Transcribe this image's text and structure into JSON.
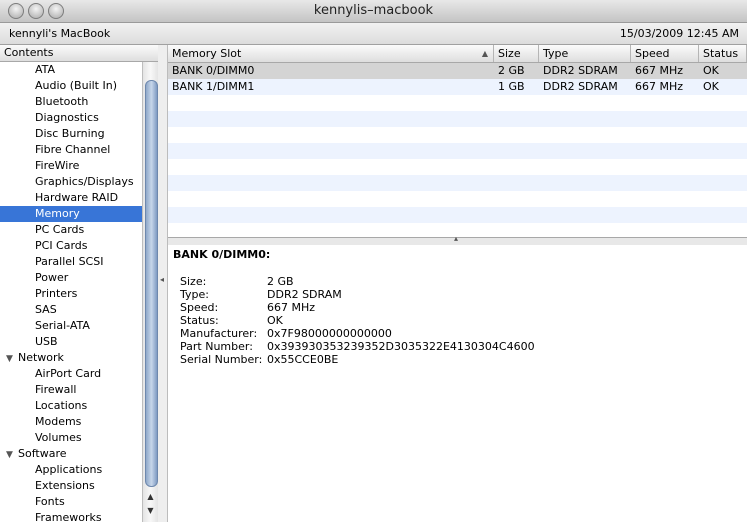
{
  "window": {
    "title": "kennylis–macbook"
  },
  "header": {
    "machine_name": "kennyli's MacBook",
    "datetime": "15/03/2009 12:45 AM"
  },
  "sidebar": {
    "header": "Contents",
    "items": [
      {
        "label": "ATA",
        "type": "item"
      },
      {
        "label": "Audio (Built In)",
        "type": "item"
      },
      {
        "label": "Bluetooth",
        "type": "item"
      },
      {
        "label": "Diagnostics",
        "type": "item"
      },
      {
        "label": "Disc Burning",
        "type": "item"
      },
      {
        "label": "Fibre Channel",
        "type": "item"
      },
      {
        "label": "FireWire",
        "type": "item"
      },
      {
        "label": "Graphics/Displays",
        "type": "item"
      },
      {
        "label": "Hardware RAID",
        "type": "item"
      },
      {
        "label": "Memory",
        "type": "item",
        "selected": true
      },
      {
        "label": "PC Cards",
        "type": "item"
      },
      {
        "label": "PCI Cards",
        "type": "item"
      },
      {
        "label": "Parallel SCSI",
        "type": "item"
      },
      {
        "label": "Power",
        "type": "item"
      },
      {
        "label": "Printers",
        "type": "item"
      },
      {
        "label": "SAS",
        "type": "item"
      },
      {
        "label": "Serial-ATA",
        "type": "item"
      },
      {
        "label": "USB",
        "type": "item"
      },
      {
        "label": "Network",
        "type": "group"
      },
      {
        "label": "AirPort Card",
        "type": "item"
      },
      {
        "label": "Firewall",
        "type": "item"
      },
      {
        "label": "Locations",
        "type": "item"
      },
      {
        "label": "Modems",
        "type": "item"
      },
      {
        "label": "Volumes",
        "type": "item"
      },
      {
        "label": "Software",
        "type": "group"
      },
      {
        "label": "Applications",
        "type": "item"
      },
      {
        "label": "Extensions",
        "type": "item"
      },
      {
        "label": "Fonts",
        "type": "item"
      },
      {
        "label": "Frameworks",
        "type": "item"
      }
    ]
  },
  "table": {
    "columns": [
      "Memory Slot",
      "Size",
      "Type",
      "Speed",
      "Status"
    ],
    "sort_column": "Memory Slot",
    "rows": [
      [
        "BANK 0/DIMM0",
        "2 GB",
        "DDR2 SDRAM",
        "667 MHz",
        "OK"
      ],
      [
        "BANK 1/DIMM1",
        "1 GB",
        "DDR2 SDRAM",
        "667 MHz",
        "OK"
      ]
    ],
    "selected_row": 0
  },
  "detail": {
    "title": "BANK 0/DIMM0:",
    "fields": [
      {
        "key": "Size:",
        "value": "2 GB"
      },
      {
        "key": "Type:",
        "value": "DDR2 SDRAM"
      },
      {
        "key": "Speed:",
        "value": "667 MHz"
      },
      {
        "key": "Status:",
        "value": "OK"
      },
      {
        "key": "Manufacturer:",
        "value": "0x7F98000000000000"
      },
      {
        "key": "Part Number:",
        "value": "0x393930353239352D3035322E4130304C4600"
      },
      {
        "key": "Serial Number:",
        "value": "0x55CCE0BE"
      }
    ]
  },
  "colors": {
    "selection": "#3875d7",
    "alt_row": "#edf3fe",
    "selected_table_row": "#d4d4d4"
  },
  "icons": [
    "close-window-icon",
    "minimize-window-icon",
    "zoom-window-icon",
    "disclosure-triangle-icon",
    "sort-ascending-icon",
    "scroll-up-icon",
    "scroll-down-icon",
    "splitter-grip-icon"
  ]
}
